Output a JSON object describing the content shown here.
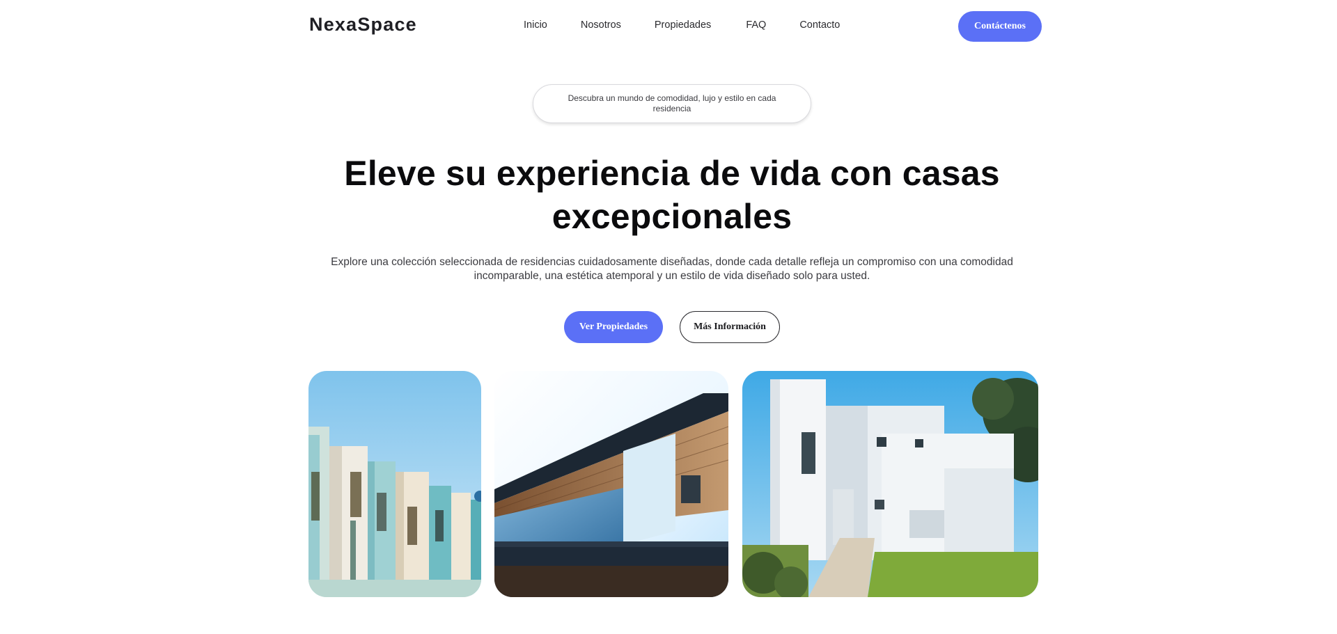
{
  "brand": {
    "logo": "NexaSpace"
  },
  "nav": {
    "items": [
      {
        "label": "Inicio"
      },
      {
        "label": "Nosotros"
      },
      {
        "label": "Propiedades"
      },
      {
        "label": "FAQ"
      },
      {
        "label": "Contacto"
      }
    ],
    "cta_label": "Contáctenos"
  },
  "hero": {
    "tagline": "Descubra un mundo de comodidad, lujo y estilo en cada residencia",
    "title": "Eleve su experiencia de vida con casas excepcionales",
    "subtitle": "Explore una colección seleccionada de residencias cuidadosamente diseñadas, donde cada detalle refleja un compromiso con una comodidad incomparable, una estética atemporal y un estilo de vida diseñado solo para usted.",
    "primary_button": "Ver Propiedades",
    "secondary_button": "Más Información"
  },
  "gallery": {
    "images": [
      {
        "name": "turquoise-townhouses-photo"
      },
      {
        "name": "modern-wood-house-photo"
      },
      {
        "name": "white-villa-photo"
      }
    ]
  },
  "colors": {
    "accent": "#5b70f6",
    "text_dark": "#0b0b0d",
    "background": "#ffffff"
  }
}
